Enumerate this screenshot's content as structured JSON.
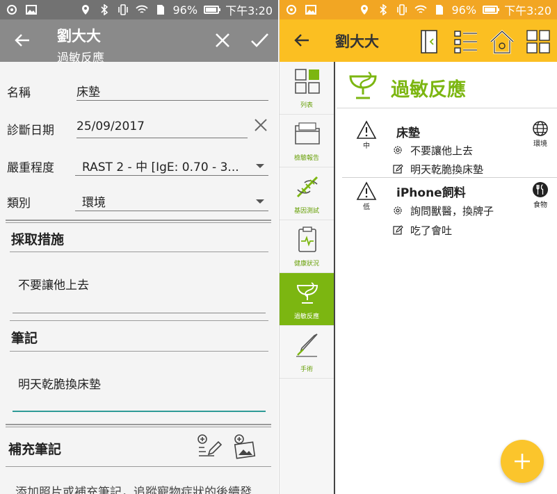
{
  "status": {
    "battery": "96%",
    "time": "下午3:20",
    "battery_level": 0.96
  },
  "left": {
    "header": {
      "title": "劉大大",
      "subtitle": "過敏反應"
    },
    "fields": [
      {
        "label": "名稱",
        "value": "床墊"
      },
      {
        "label": "診斷日期",
        "value": "25/09/2017"
      },
      {
        "label": "嚴重程度",
        "value": "RAST 2 - 中 [IgE: 0.70 - 3..."
      },
      {
        "label": "類別",
        "value": "環境"
      }
    ],
    "measures": {
      "title": "採取措施",
      "text": "不要讓他上去"
    },
    "notes": {
      "title": "筆記",
      "text": "明天乾脆換床墊"
    },
    "supplement": {
      "title": "補充筆記",
      "hint": "添加照片或補充筆記，追蹤寵物症狀的後續發"
    }
  },
  "right": {
    "header": {
      "title": "劉大大"
    },
    "rail": [
      {
        "label": "列表",
        "icon": "grid-icon",
        "active": false
      },
      {
        "label": "檢驗報告",
        "icon": "folder-icon",
        "active": false
      },
      {
        "label": "基因測試",
        "icon": "dna-icon",
        "active": false
      },
      {
        "label": "健康狀況",
        "icon": "clipboard-pulse-icon",
        "active": false
      },
      {
        "label": "過敏反應",
        "icon": "bowl-of-hygieia-icon",
        "active": true
      },
      {
        "label": "手術",
        "icon": "scalpel-icon",
        "active": false
      }
    ],
    "page_title": "過敏反應",
    "entries": [
      {
        "title": "床墊",
        "severity": "中",
        "category": "環境",
        "category_icon": "globe-icon",
        "measure": "不要讓他上去",
        "note": "明天乾脆換床墊"
      },
      {
        "title": "iPhone飼料",
        "severity": "低",
        "category": "食物",
        "category_icon": "food-icon",
        "measure": "詢問獸醫，換牌子",
        "note": "吃了會吐"
      }
    ]
  },
  "colors": {
    "accent_green": "#7cb611",
    "accent_yellow": "#fbbf22",
    "teal": "#2e9a96"
  }
}
